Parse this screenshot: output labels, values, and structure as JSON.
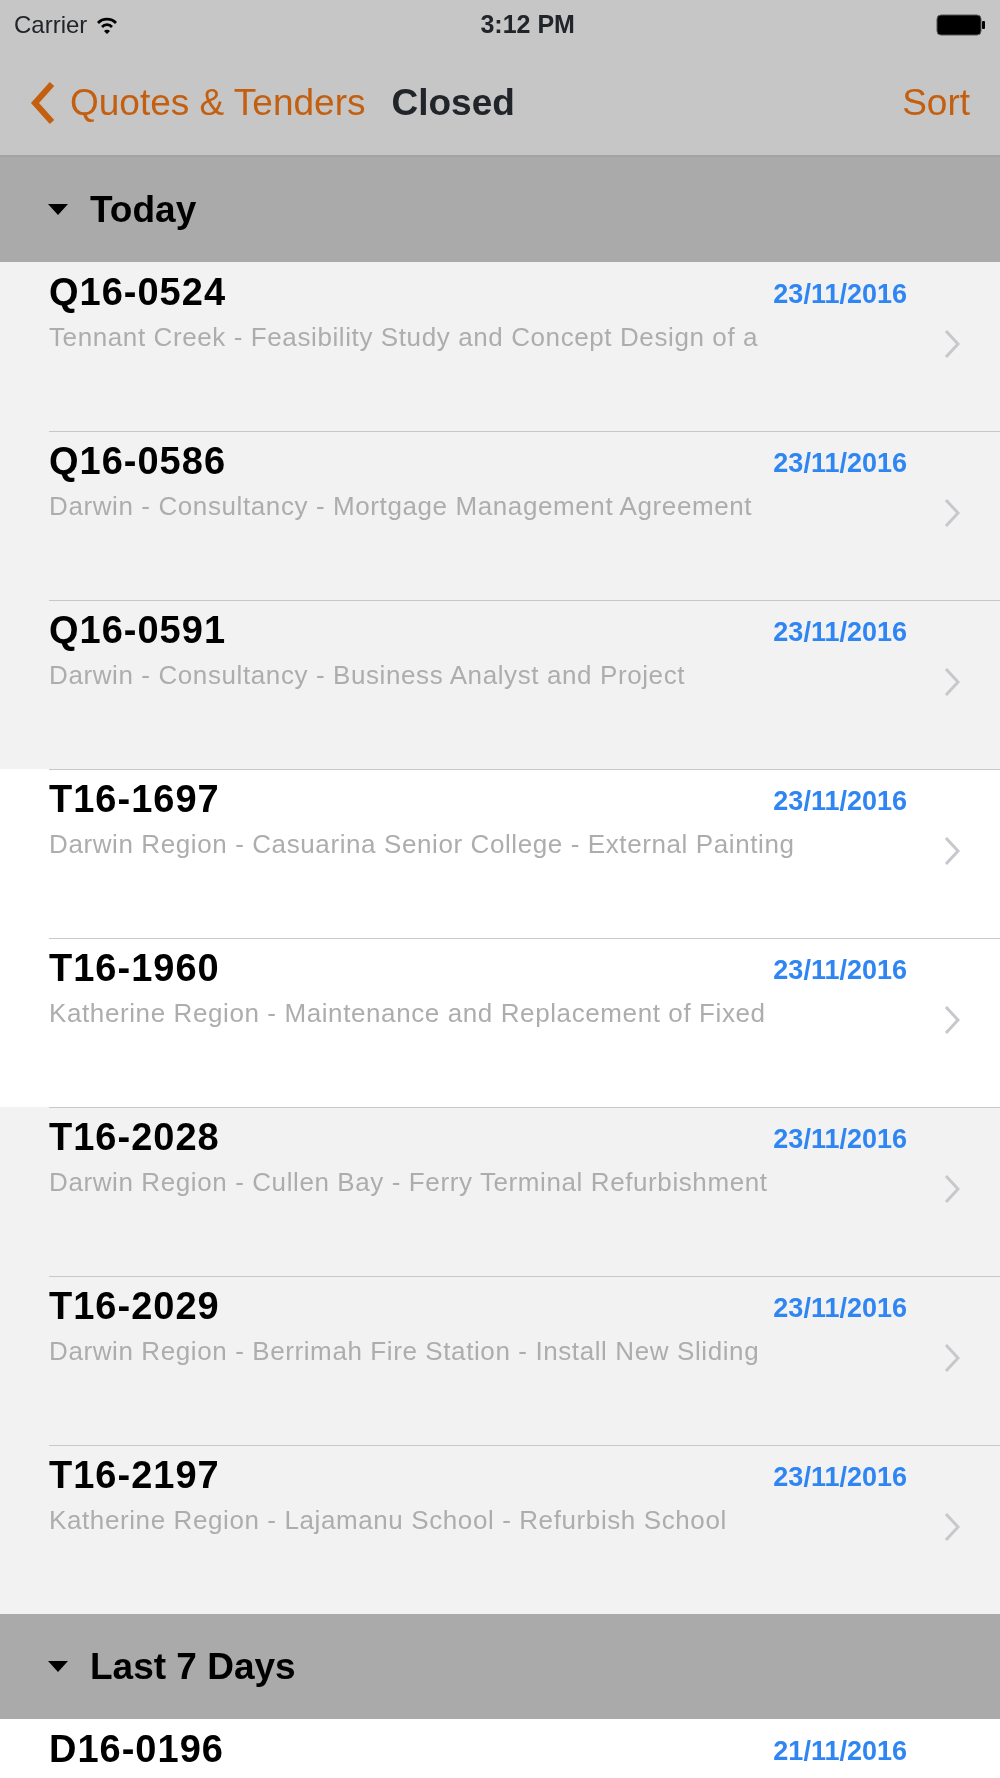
{
  "status_bar": {
    "carrier": "Carrier",
    "time": "3:12 PM"
  },
  "nav_bar": {
    "back": "Quotes & Tenders",
    "title": "Closed",
    "action": "Sort"
  },
  "sections": [
    {
      "title": "Today",
      "expanded": true,
      "rows": [
        {
          "code": "Q16-0524",
          "date": "23/11/2016",
          "description": "Tennant Creek - Feasibility Study and Concept Design of a",
          "shaded": true
        },
        {
          "code": "Q16-0586",
          "date": "23/11/2016",
          "description": "Darwin - Consultancy - Mortgage Management Agreement",
          "shaded": true
        },
        {
          "code": "Q16-0591",
          "date": "23/11/2016",
          "description": "Darwin - Consultancy - Business Analyst and Project",
          "shaded": true
        },
        {
          "code": "T16-1697",
          "date": "23/11/2016",
          "description": "Darwin Region - Casuarina Senior College - External Painting",
          "shaded": false
        },
        {
          "code": "T16-1960",
          "date": "23/11/2016",
          "description": "Katherine Region - Maintenance and Replacement of Fixed",
          "shaded": false
        },
        {
          "code": "T16-2028",
          "date": "23/11/2016",
          "description": "Darwin Region - Cullen Bay - Ferry Terminal Refurbishment",
          "shaded": true
        },
        {
          "code": "T16-2029",
          "date": "23/11/2016",
          "description": "Darwin Region - Berrimah Fire Station - Install New Sliding",
          "shaded": true
        },
        {
          "code": "T16-2197",
          "date": "23/11/2016",
          "description": "Katherine Region - Lajamanu School - Refurbish School",
          "shaded": true
        }
      ]
    },
    {
      "title": "Last 7 Days",
      "expanded": true,
      "rows": [
        {
          "code": "D16-0196",
          "date": "21/11/2016",
          "shaded": false
        }
      ]
    }
  ]
}
